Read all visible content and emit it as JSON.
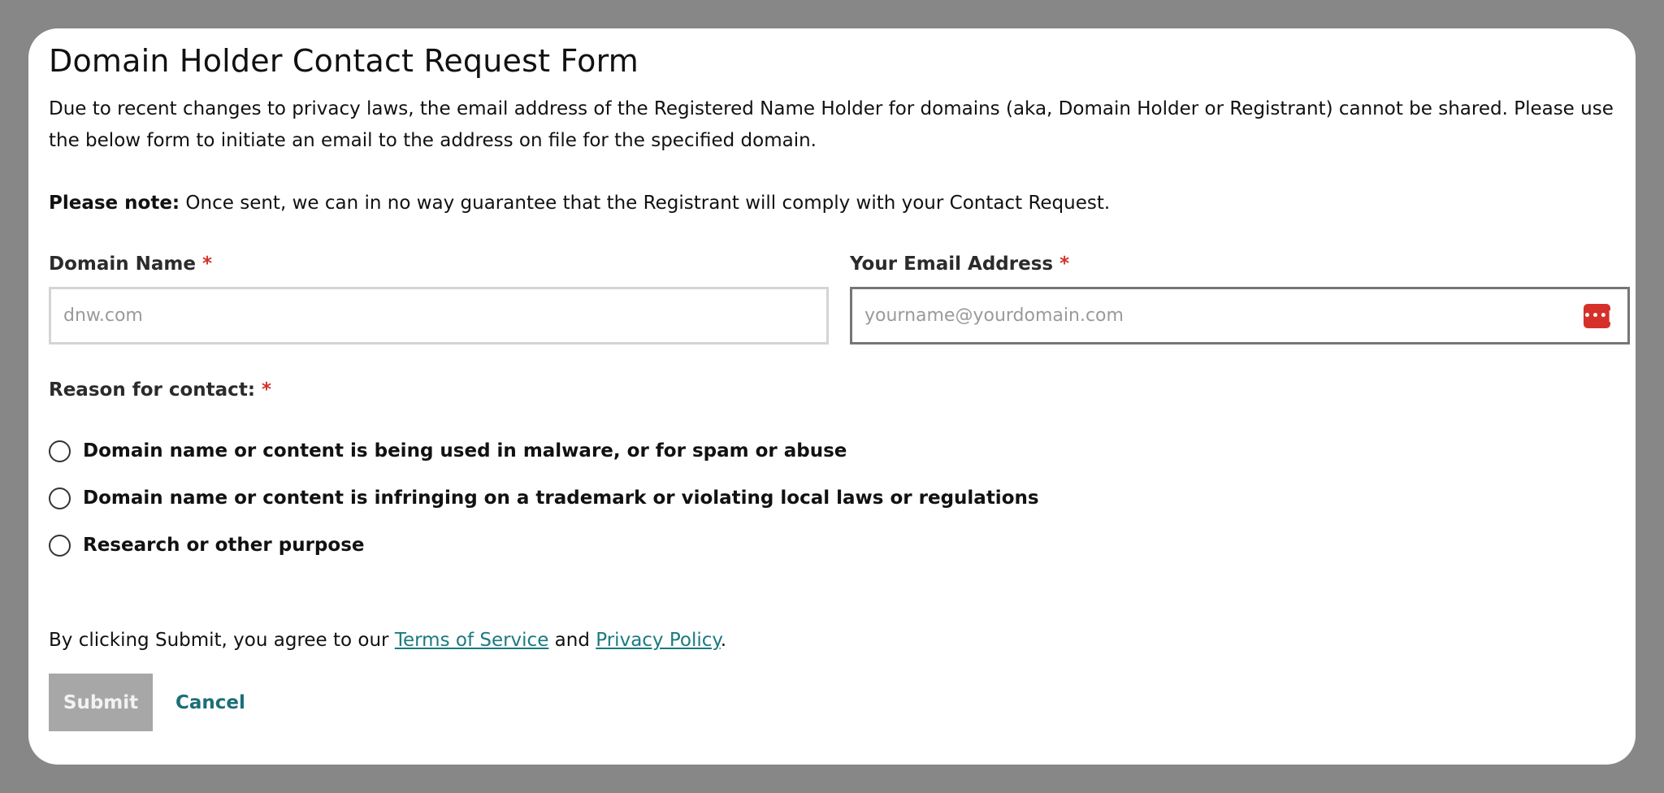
{
  "form": {
    "title": "Domain Holder Contact Request Form",
    "intro": "Due to recent changes to privacy laws, the email address of the Registered Name Holder for domains (aka, Domain Holder or Registrant) cannot be shared. Please use the below form to initiate an email to the address on file for the specified domain.",
    "note_label": "Please note:",
    "note_text": " Once sent, we can in no way guarantee that the Registrant will comply with your Contact Request.",
    "required_marker": "*",
    "domain_field": {
      "label": "Domain Name",
      "placeholder": "dnw.com",
      "value": ""
    },
    "email_field": {
      "label": "Your Email Address",
      "placeholder": "yourname@yourdomain.com",
      "value": "",
      "password_manager_icon": "password-manager-icon",
      "password_manager_glyph": "•••|"
    },
    "reason": {
      "label": "Reason for contact:",
      "options": [
        "Domain name or content is being used in malware, or for spam or abuse",
        "Domain name or content is infringing on a trademark or violating local laws or regulations",
        "Research or other purpose"
      ]
    },
    "agreement": {
      "prefix": "By clicking Submit, you agree to our ",
      "terms_link": "Terms of Service",
      "middle": " and ",
      "privacy_link": "Privacy Policy",
      "suffix": "."
    },
    "submit_label": "Submit",
    "cancel_label": "Cancel"
  },
  "colors": {
    "backdrop": "#878787",
    "required": "#d5302a",
    "link": "#1b7a80",
    "submit_disabled": "#a7a7a7"
  }
}
